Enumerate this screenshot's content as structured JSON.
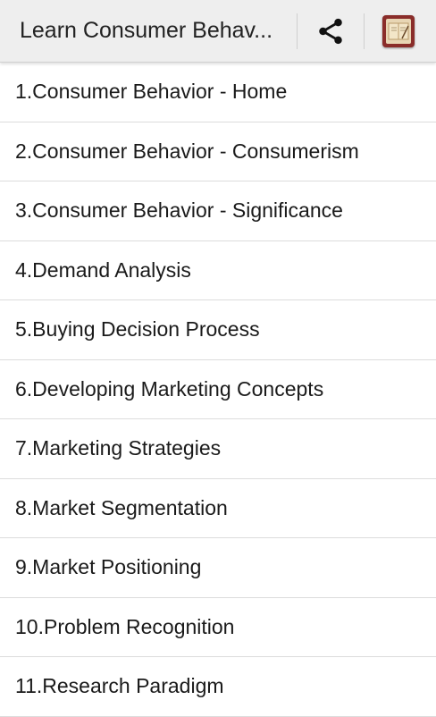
{
  "appbar": {
    "title": "Learn Consumer Behav...",
    "share_icon": "share-icon",
    "app_icon": "book-icon"
  },
  "colors": {
    "appbar_bg": "#eeeeee",
    "divider": "#dcdcdc",
    "text": "#1a1a1a"
  },
  "items": [
    "1.Consumer Behavior - Home",
    "2.Consumer Behavior - Consumerism",
    "3.Consumer Behavior - Significance",
    "4.Demand Analysis",
    "5.Buying Decision Process",
    "6.Developing Marketing Concepts",
    "7.Marketing Strategies",
    "8.Market Segmentation",
    "9.Market Positioning",
    "10.Problem Recognition",
    "11.Research Paradigm"
  ]
}
